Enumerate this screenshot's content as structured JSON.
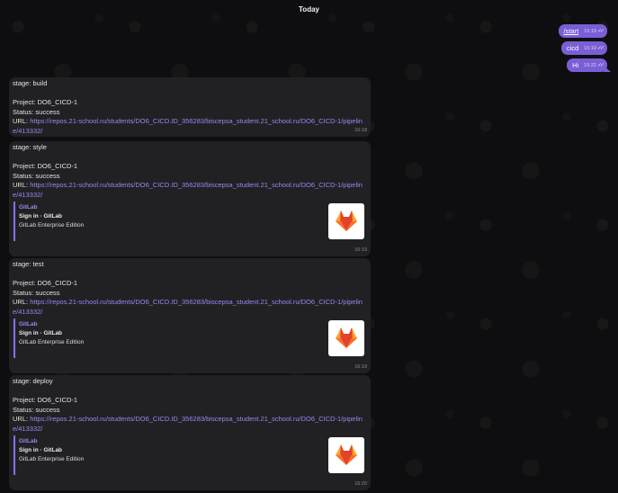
{
  "date_separator": "Today",
  "outgoing": [
    {
      "text": "/start",
      "time": "15:19"
    },
    {
      "text": "cicd",
      "time": "15:19"
    },
    {
      "text": "Hi",
      "time": "15:22"
    }
  ],
  "messages": [
    {
      "stage": "stage: build",
      "project": "Project: DO6_CICD-1",
      "status": "Status: success",
      "url_label": "URL:",
      "url": "https://repos.21-school.ru/students/DO6_CICD.ID_356283/biscepsa_student.21_school.ru/DO6_CICD-1/pipeline/413332/",
      "time": "16:18"
    },
    {
      "stage": "stage: style",
      "project": "Project: DO6_CICD-1",
      "status": "Status: success",
      "url_label": "URL:",
      "url": "https://repos.21-school.ru/students/DO6_CICD.ID_356283/biscepsa_student.21_school.ru/DO6_CICD-1/pipeline/413332/",
      "preview": {
        "site": "GitLab",
        "title": "Sign in · GitLab",
        "description": "GitLab Enterprise Edition"
      },
      "time": "16:19"
    },
    {
      "stage": "stage: test",
      "project": "Project: DO6_CICD-1",
      "status": "Status: success",
      "url_label": "URL:",
      "url": "https://repos.21-school.ru/students/DO6_CICD.ID_356283/biscepsa_student.21_school.ru/DO6_CICD-1/pipeline/413332/",
      "preview": {
        "site": "GitLab",
        "title": "Sign in · GitLab",
        "description": "GitLab Enterprise Edition"
      },
      "time": "16:19"
    },
    {
      "stage": "stage: deploy",
      "project": "Project: DO6_CICD-1",
      "status": "Status: success",
      "url_label": "URL:",
      "url": "https://repos.21-school.ru/students/DO6_CICD.ID_356283/biscepsa_student.21_school.ru/DO6_CICD-1/pipeline/413332/",
      "preview": {
        "site": "GitLab",
        "title": "Sign in · GitLab",
        "description": "GitLab Enterprise Edition"
      },
      "time": "16:20"
    }
  ],
  "colors": {
    "outgoing_bubble": "#7a5ed6",
    "incoming_bubble": "#212124",
    "link": "#9d86f0",
    "background": "#0e0e10"
  },
  "icons": {
    "read_receipt": "double-check-icon",
    "preview_thumbnail": "gitlab-logo"
  }
}
